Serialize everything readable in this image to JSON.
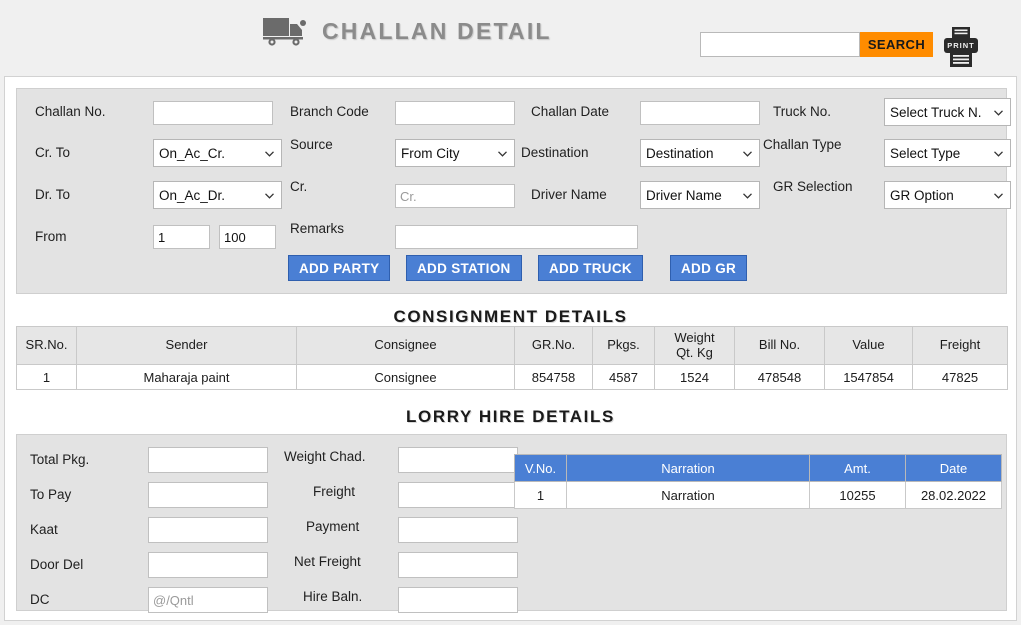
{
  "header": {
    "title": "CHALLAN DETAIL",
    "truck_icon": "truck-icon",
    "search_value": "",
    "search_placeholder": "",
    "search_label": "SEARCH",
    "print_label": "PRINT",
    "accent_orange": "#ff8c00",
    "title_color": "#8b8b8b"
  },
  "form": {
    "labels": {
      "challan_no": "Challan No.",
      "branch_code": "Branch Code",
      "challan_date": "Challan Date",
      "truck_no": "Truck No.",
      "cr_to": "Cr. To",
      "source": "Source",
      "destination": "Destination",
      "challan_type": "Challan Type",
      "dr_to": "Dr. To",
      "cr": "Cr.",
      "driver_name": "Driver Name",
      "gr_selection": "GR Selection",
      "from": "From",
      "remarks": "Remarks"
    },
    "values": {
      "challan_no": "",
      "branch_code": "",
      "challan_date": "",
      "truck_no": "Select Truck N.",
      "cr_to": "On_Ac_Cr.",
      "source": "From City",
      "destination": "Destination",
      "challan_type": "Select Type",
      "dr_to": "On_Ac_Dr.",
      "cr": "",
      "driver_name": "Driver Name",
      "gr_selection": "GR Option",
      "from_1": "1",
      "from_2": "100",
      "remarks": ""
    },
    "placeholders": {
      "cr": "Cr."
    },
    "buttons": {
      "add_party": "ADD PARTY",
      "add_station": "ADD STATION",
      "add_truck": "ADD TRUCK",
      "add_gr": "ADD GR",
      "color": "#4a7fd4"
    }
  },
  "consignment": {
    "heading": "CONSIGNMENT DETAILS",
    "columns": [
      "SR.No.",
      "Sender",
      "Consignee",
      "GR.No.",
      "Pkgs.",
      "Weight Qt. Kg",
      "Bill No.",
      "Value",
      "Freight"
    ],
    "col_weight_line1": "Weight",
    "col_weight_line2": "Qt. Kg",
    "rows": [
      {
        "sr_no": "1",
        "sender": "Maharaja paint",
        "consignee": "Consignee",
        "gr_no": "854758",
        "pkgs": "4587",
        "weight": "1524",
        "bill_no": "478548",
        "value": "1547854",
        "freight": "47825"
      }
    ]
  },
  "lorry": {
    "heading": "LORRY HIRE DETAILS",
    "labels": {
      "total_pkg": "Total Pkg.",
      "weight_chad": "Weight Chad.",
      "to_pay": "To Pay",
      "freight": "Freight",
      "kaat": "Kaat",
      "payment": "Payment",
      "door_del": "Door Del",
      "net_freight": "Net Freight",
      "dc": "DC",
      "hire_baln": "Hire Baln."
    },
    "values": {
      "total_pkg": "",
      "weight_chad": "",
      "to_pay": "",
      "freight": "",
      "kaat": "",
      "payment": "",
      "door_del": "",
      "net_freight": "",
      "dc": "",
      "hire_baln": ""
    },
    "placeholders": {
      "dc": "@/Qntl"
    },
    "narration_table": {
      "columns": [
        "V.No.",
        "Narration",
        "Amt.",
        "Date"
      ],
      "header_color": "#4a7fd4",
      "rows": [
        {
          "v_no": "1",
          "narration": "Narration",
          "amt": "10255",
          "date": "28.02.2022"
        }
      ]
    }
  }
}
